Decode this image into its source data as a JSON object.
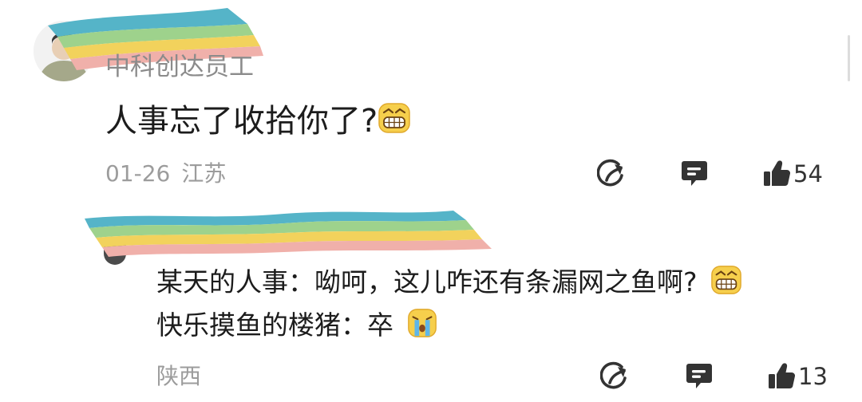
{
  "main_comment": {
    "username": "中科创达员工",
    "text": "人事忘了收拾你了?",
    "emoji_icon": "grin-emoji-icon",
    "date": "01-26",
    "location": "江苏",
    "like_count": "54"
  },
  "reply": {
    "lines": [
      {
        "author": "某天的人事：",
        "text": "呦呵，这儿咋还有条漏网之鱼啊?",
        "emoji_icon": "grin-emoji-icon"
      },
      {
        "author": "快乐摸鱼的楼猪：",
        "text": " 卒",
        "emoji_icon": "crying-emoji-icon"
      }
    ],
    "location": "陕西",
    "like_count": "13"
  },
  "icons": {
    "share": "share-icon",
    "comment": "comment-icon",
    "like": "thumbs-up-icon"
  },
  "colors": {
    "text_primary": "#1c1c1c",
    "text_secondary": "#9c9c9c",
    "username": "#8b8b8b",
    "icon": "#333333",
    "censor_stripes": [
      "#55b4c8",
      "#9ed28c",
      "#f2d25c",
      "#f0b0aa"
    ]
  }
}
